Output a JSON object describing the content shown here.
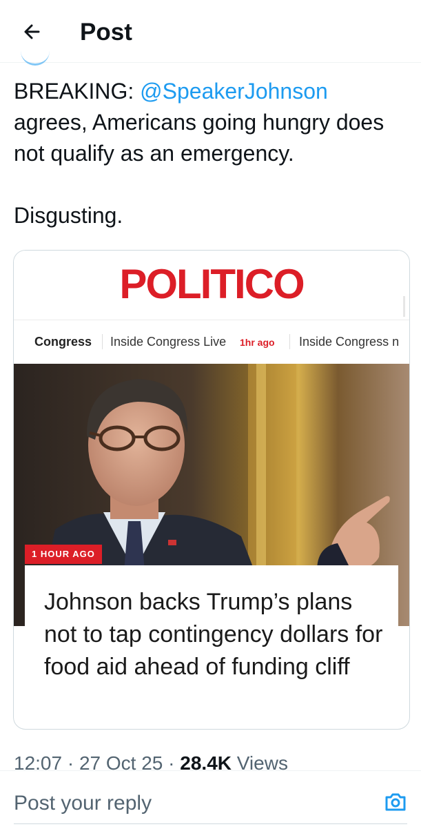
{
  "header": {
    "title": "Post"
  },
  "tweet": {
    "line1_prefix": "BREAKING: ",
    "mention": "@SpeakerJohnson",
    "line1_rest": " agrees, Americans going hungry does not qualify as an emergency.",
    "line2": "Disgusting."
  },
  "card": {
    "logo": "POLITICO",
    "nav": {
      "item1": "Congress",
      "item2": "Inside Congress Live",
      "item2_time": "1hr ago",
      "item3": "Inside Congress n"
    },
    "badge": "1 HOUR AGO",
    "headline": "Johnson backs Trump’s plans not to tap contingency dollars for food aid ahead of funding cliff"
  },
  "meta": {
    "time": "12:07",
    "dot1": " · ",
    "date": "27 Oct 25",
    "dot2": " · ",
    "views_count": "28.4K",
    "views_label": " Views"
  },
  "reply": {
    "placeholder": "Post your reply"
  },
  "colors": {
    "accent": "#1d9bf0",
    "politico_red": "#dc1e27",
    "text": "#0f1419",
    "muted": "#536471"
  }
}
